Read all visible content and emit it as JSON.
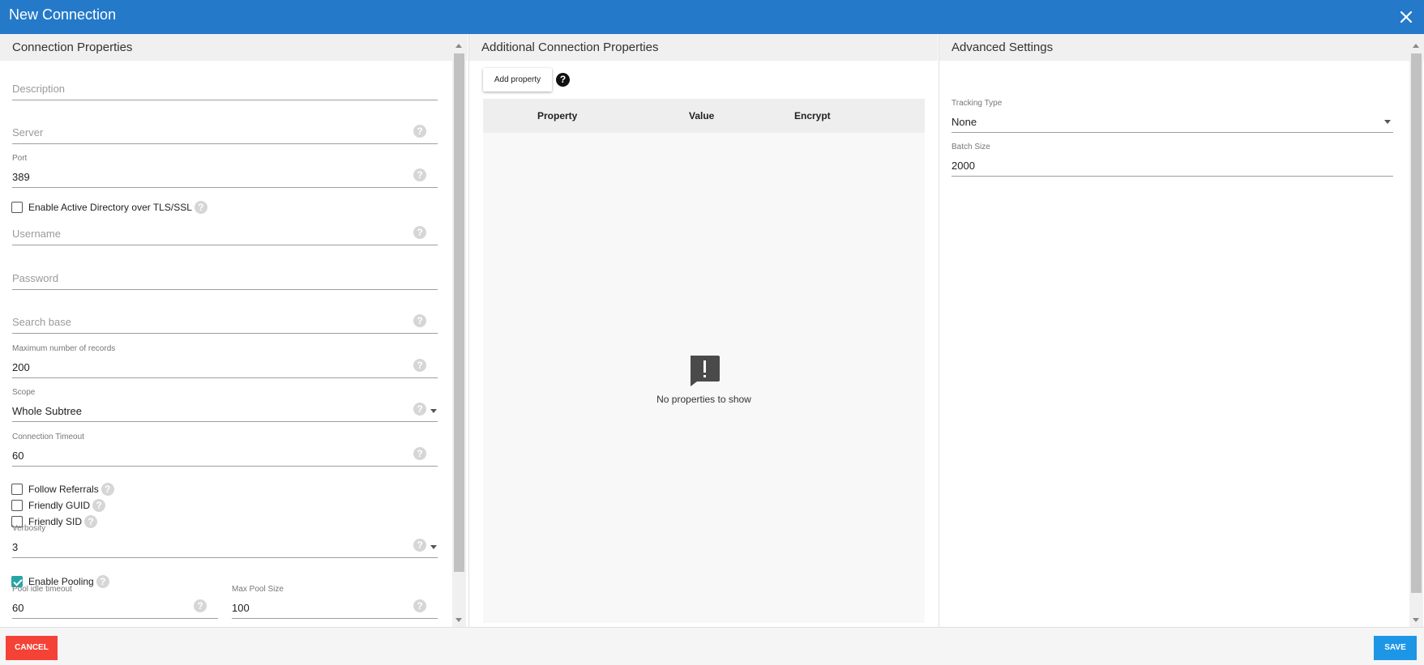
{
  "window": {
    "title": "New Connection",
    "close_icon": "close-icon"
  },
  "left_panel": {
    "header": "Connection Properties",
    "description": {
      "placeholder": "Description"
    },
    "server": {
      "placeholder": "Server"
    },
    "port": {
      "label": "Port",
      "value": "389"
    },
    "enable_ad_tls": {
      "label": "Enable Active Directory over TLS/SSL",
      "checked": false
    },
    "username": {
      "placeholder": "Username"
    },
    "password": {
      "placeholder": "Password"
    },
    "search_base": {
      "placeholder": "Search base"
    },
    "max_records": {
      "label": "Maximum number of records",
      "value": "200"
    },
    "scope": {
      "label": "Scope",
      "value": "Whole Subtree"
    },
    "connection_timeout": {
      "label": "Connection Timeout",
      "value": "60"
    },
    "follow_referrals": {
      "label": "Follow Referrals",
      "checked": false
    },
    "friendly_guid": {
      "label": "Friendly GUID",
      "checked": false
    },
    "friendly_sid": {
      "label": "Friendly SID",
      "checked": false
    },
    "verbosity": {
      "label": "Verbosity",
      "value": "3"
    },
    "enable_pooling": {
      "label": "Enable Pooling",
      "checked": true
    },
    "pool_idle_timeout": {
      "label": "Pool idle timeout",
      "value": "60"
    },
    "max_pool_size": {
      "label": "Max Pool Size",
      "value": "100"
    }
  },
  "middle_panel": {
    "header": "Additional Connection Properties",
    "add_property_label": "Add property",
    "columns": [
      "Property",
      "Value",
      "Encrypt"
    ],
    "empty_text": "No properties to show"
  },
  "right_panel": {
    "header": "Advanced Settings",
    "tracking_type": {
      "label": "Tracking Type",
      "value": "None"
    },
    "batch_size": {
      "label": "Batch Size",
      "value": "2000"
    }
  },
  "footer": {
    "cancel_label": "CANCEL",
    "save_label": "SAVE"
  },
  "colors": {
    "titlebar": "#2479c9",
    "cancel": "#f44336",
    "save": "#1e96e6",
    "checkbox_on": "#26a6a6"
  }
}
